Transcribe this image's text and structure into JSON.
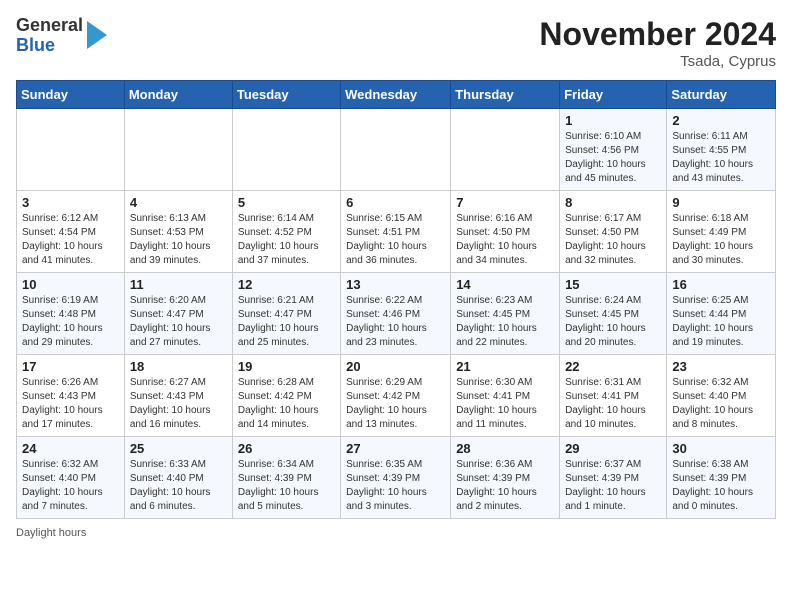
{
  "header": {
    "logo_general": "General",
    "logo_blue": "Blue",
    "title": "November 2024",
    "subtitle": "Tsada, Cyprus"
  },
  "days_of_week": [
    "Sunday",
    "Monday",
    "Tuesday",
    "Wednesday",
    "Thursday",
    "Friday",
    "Saturday"
  ],
  "weeks": [
    [
      {
        "day": "",
        "sunrise": "",
        "sunset": "",
        "daylight": ""
      },
      {
        "day": "",
        "sunrise": "",
        "sunset": "",
        "daylight": ""
      },
      {
        "day": "",
        "sunrise": "",
        "sunset": "",
        "daylight": ""
      },
      {
        "day": "",
        "sunrise": "",
        "sunset": "",
        "daylight": ""
      },
      {
        "day": "",
        "sunrise": "",
        "sunset": "",
        "daylight": ""
      },
      {
        "day": "1",
        "sunrise": "Sunrise: 6:10 AM",
        "sunset": "Sunset: 4:56 PM",
        "daylight": "Daylight: 10 hours and 45 minutes."
      },
      {
        "day": "2",
        "sunrise": "Sunrise: 6:11 AM",
        "sunset": "Sunset: 4:55 PM",
        "daylight": "Daylight: 10 hours and 43 minutes."
      }
    ],
    [
      {
        "day": "3",
        "sunrise": "Sunrise: 6:12 AM",
        "sunset": "Sunset: 4:54 PM",
        "daylight": "Daylight: 10 hours and 41 minutes."
      },
      {
        "day": "4",
        "sunrise": "Sunrise: 6:13 AM",
        "sunset": "Sunset: 4:53 PM",
        "daylight": "Daylight: 10 hours and 39 minutes."
      },
      {
        "day": "5",
        "sunrise": "Sunrise: 6:14 AM",
        "sunset": "Sunset: 4:52 PM",
        "daylight": "Daylight: 10 hours and 37 minutes."
      },
      {
        "day": "6",
        "sunrise": "Sunrise: 6:15 AM",
        "sunset": "Sunset: 4:51 PM",
        "daylight": "Daylight: 10 hours and 36 minutes."
      },
      {
        "day": "7",
        "sunrise": "Sunrise: 6:16 AM",
        "sunset": "Sunset: 4:50 PM",
        "daylight": "Daylight: 10 hours and 34 minutes."
      },
      {
        "day": "8",
        "sunrise": "Sunrise: 6:17 AM",
        "sunset": "Sunset: 4:50 PM",
        "daylight": "Daylight: 10 hours and 32 minutes."
      },
      {
        "day": "9",
        "sunrise": "Sunrise: 6:18 AM",
        "sunset": "Sunset: 4:49 PM",
        "daylight": "Daylight: 10 hours and 30 minutes."
      }
    ],
    [
      {
        "day": "10",
        "sunrise": "Sunrise: 6:19 AM",
        "sunset": "Sunset: 4:48 PM",
        "daylight": "Daylight: 10 hours and 29 minutes."
      },
      {
        "day": "11",
        "sunrise": "Sunrise: 6:20 AM",
        "sunset": "Sunset: 4:47 PM",
        "daylight": "Daylight: 10 hours and 27 minutes."
      },
      {
        "day": "12",
        "sunrise": "Sunrise: 6:21 AM",
        "sunset": "Sunset: 4:47 PM",
        "daylight": "Daylight: 10 hours and 25 minutes."
      },
      {
        "day": "13",
        "sunrise": "Sunrise: 6:22 AM",
        "sunset": "Sunset: 4:46 PM",
        "daylight": "Daylight: 10 hours and 23 minutes."
      },
      {
        "day": "14",
        "sunrise": "Sunrise: 6:23 AM",
        "sunset": "Sunset: 4:45 PM",
        "daylight": "Daylight: 10 hours and 22 minutes."
      },
      {
        "day": "15",
        "sunrise": "Sunrise: 6:24 AM",
        "sunset": "Sunset: 4:45 PM",
        "daylight": "Daylight: 10 hours and 20 minutes."
      },
      {
        "day": "16",
        "sunrise": "Sunrise: 6:25 AM",
        "sunset": "Sunset: 4:44 PM",
        "daylight": "Daylight: 10 hours and 19 minutes."
      }
    ],
    [
      {
        "day": "17",
        "sunrise": "Sunrise: 6:26 AM",
        "sunset": "Sunset: 4:43 PM",
        "daylight": "Daylight: 10 hours and 17 minutes."
      },
      {
        "day": "18",
        "sunrise": "Sunrise: 6:27 AM",
        "sunset": "Sunset: 4:43 PM",
        "daylight": "Daylight: 10 hours and 16 minutes."
      },
      {
        "day": "19",
        "sunrise": "Sunrise: 6:28 AM",
        "sunset": "Sunset: 4:42 PM",
        "daylight": "Daylight: 10 hours and 14 minutes."
      },
      {
        "day": "20",
        "sunrise": "Sunrise: 6:29 AM",
        "sunset": "Sunset: 4:42 PM",
        "daylight": "Daylight: 10 hours and 13 minutes."
      },
      {
        "day": "21",
        "sunrise": "Sunrise: 6:30 AM",
        "sunset": "Sunset: 4:41 PM",
        "daylight": "Daylight: 10 hours and 11 minutes."
      },
      {
        "day": "22",
        "sunrise": "Sunrise: 6:31 AM",
        "sunset": "Sunset: 4:41 PM",
        "daylight": "Daylight: 10 hours and 10 minutes."
      },
      {
        "day": "23",
        "sunrise": "Sunrise: 6:32 AM",
        "sunset": "Sunset: 4:40 PM",
        "daylight": "Daylight: 10 hours and 8 minutes."
      }
    ],
    [
      {
        "day": "24",
        "sunrise": "Sunrise: 6:32 AM",
        "sunset": "Sunset: 4:40 PM",
        "daylight": "Daylight: 10 hours and 7 minutes."
      },
      {
        "day": "25",
        "sunrise": "Sunrise: 6:33 AM",
        "sunset": "Sunset: 4:40 PM",
        "daylight": "Daylight: 10 hours and 6 minutes."
      },
      {
        "day": "26",
        "sunrise": "Sunrise: 6:34 AM",
        "sunset": "Sunset: 4:39 PM",
        "daylight": "Daylight: 10 hours and 5 minutes."
      },
      {
        "day": "27",
        "sunrise": "Sunrise: 6:35 AM",
        "sunset": "Sunset: 4:39 PM",
        "daylight": "Daylight: 10 hours and 3 minutes."
      },
      {
        "day": "28",
        "sunrise": "Sunrise: 6:36 AM",
        "sunset": "Sunset: 4:39 PM",
        "daylight": "Daylight: 10 hours and 2 minutes."
      },
      {
        "day": "29",
        "sunrise": "Sunrise: 6:37 AM",
        "sunset": "Sunset: 4:39 PM",
        "daylight": "Daylight: 10 hours and 1 minute."
      },
      {
        "day": "30",
        "sunrise": "Sunrise: 6:38 AM",
        "sunset": "Sunset: 4:39 PM",
        "daylight": "Daylight: 10 hours and 0 minutes."
      }
    ]
  ],
  "footer": "Daylight hours"
}
